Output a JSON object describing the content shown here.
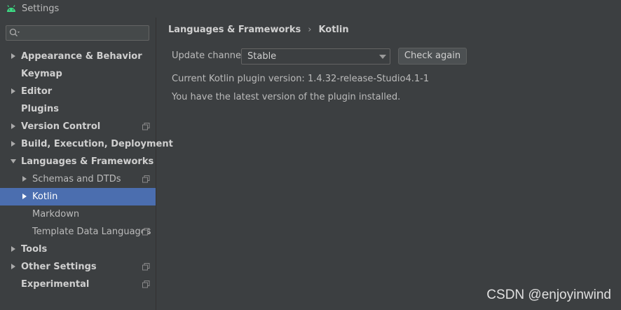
{
  "window": {
    "title": "Settings",
    "app_icon": "android-icon"
  },
  "search": {
    "value": "",
    "icon": "search-icon"
  },
  "tree": [
    {
      "label": "Appearance & Behavior",
      "level": 0,
      "bold": true,
      "arrow": "right",
      "project": false,
      "selected": false
    },
    {
      "label": "Keymap",
      "level": 0,
      "bold": true,
      "arrow": "",
      "project": false,
      "selected": false
    },
    {
      "label": "Editor",
      "level": 0,
      "bold": true,
      "arrow": "right",
      "project": false,
      "selected": false
    },
    {
      "label": "Plugins",
      "level": 0,
      "bold": true,
      "arrow": "",
      "project": false,
      "selected": false
    },
    {
      "label": "Version Control",
      "level": 0,
      "bold": true,
      "arrow": "right",
      "project": true,
      "selected": false
    },
    {
      "label": "Build, Execution, Deployment",
      "level": 0,
      "bold": true,
      "arrow": "right",
      "project": false,
      "selected": false
    },
    {
      "label": "Languages & Frameworks",
      "level": 0,
      "bold": true,
      "arrow": "down",
      "project": false,
      "selected": false
    },
    {
      "label": "Schemas and DTDs",
      "level": 1,
      "bold": false,
      "arrow": "right",
      "project": true,
      "selected": false
    },
    {
      "label": "Kotlin",
      "level": 1,
      "bold": false,
      "arrow": "right",
      "project": false,
      "selected": true
    },
    {
      "label": "Markdown",
      "level": 1,
      "bold": false,
      "arrow": "",
      "project": false,
      "selected": false
    },
    {
      "label": "Template Data Languages",
      "level": 1,
      "bold": false,
      "arrow": "",
      "project": true,
      "selected": false
    },
    {
      "label": "Tools",
      "level": 0,
      "bold": true,
      "arrow": "right",
      "project": false,
      "selected": false
    },
    {
      "label": "Other Settings",
      "level": 0,
      "bold": true,
      "arrow": "right",
      "project": true,
      "selected": false
    },
    {
      "label": "Experimental",
      "level": 0,
      "bold": true,
      "arrow": "",
      "project": true,
      "selected": false
    }
  ],
  "breadcrumb": {
    "parent": "Languages & Frameworks",
    "separator": "›",
    "current": "Kotlin"
  },
  "update_channel": {
    "label": "Update channel:",
    "value": "Stable"
  },
  "check_again_label": "Check again",
  "version_text": "Current Kotlin plugin version:  1.4.32-release-Studio4.1-1",
  "status_text": "You have the latest version of the plugin installed.",
  "watermark": "CSDN @enjoyinwind",
  "colors": {
    "background": "#3c3f41",
    "selection": "#4b6eaf",
    "text": "#bbbbbb",
    "android_green": "#3ddc84"
  }
}
